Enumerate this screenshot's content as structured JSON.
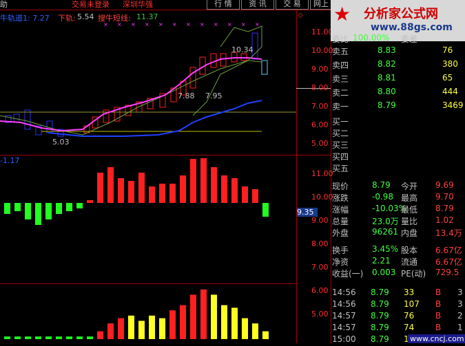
{
  "menu": {
    "help": "助",
    "account_status": "交易未登录",
    "stock_title": "深圳华强",
    "buttons": [
      "行 情",
      "资 讯",
      "交 易",
      "网上"
    ],
    "close_icon": "◇"
  },
  "watermark": {
    "title": "分析家公式网",
    "url": "www.88gs.com",
    "footer": "www.cncj.com"
  },
  "main_chart": {
    "indicator_name": "牛轨道1: 7.27",
    "lower_label": "下轨:",
    "lower_value": "5.54",
    "short_label": "搜牛短线:",
    "short_value": "11.37",
    "annotations": [
      "10.34",
      "7.88",
      "7.95",
      "5.03"
    ],
    "y_labels": [
      "11.00",
      "10.00",
      "9.00",
      "8.00",
      "7.00",
      "6.00",
      "5.00"
    ],
    "colors": {
      "up": "#ff2020",
      "down": "#3030ff",
      "pink": "#ff40ff",
      "green_line": "#70a040",
      "blue_line": "#2040ff",
      "flat": "#c0c000"
    }
  },
  "mid_chart": {
    "indicator_value": "-1.17",
    "marker": "9.35",
    "y_labels": [
      "11.00",
      "10.00",
      "9.00",
      "8.00",
      "7.00",
      "6.00",
      "5.00"
    ],
    "bars": [
      -0.4,
      -0.3,
      -0.6,
      -0.8,
      -0.6,
      -0.4,
      -0.3,
      -0.2,
      0.1,
      1.1,
      1.3,
      0.9,
      0.8,
      1.1,
      0.6,
      0.7,
      0.7,
      1.0,
      1.6,
      1.9,
      1.3,
      1.0,
      0.9,
      0.6,
      0.5,
      -0.5
    ]
  },
  "bottom_chart": {
    "bars": [
      0.1,
      0.1,
      0.1,
      0.1,
      0.1,
      0.1,
      0.1,
      0.1,
      0.1,
      0.3,
      0.6,
      0.8,
      0.9,
      0.7,
      0.9,
      0.8,
      1.1,
      1.3,
      1.7,
      1.9,
      1.7,
      1.3,
      1.2,
      0.8,
      0.6,
      0.3
    ],
    "bar_colors": [
      "g",
      "g",
      "g",
      "g",
      "g",
      "g",
      "g",
      "g",
      "g",
      "r",
      "r",
      "r",
      "y",
      "y",
      "y",
      "y",
      "r",
      "r",
      "r",
      "r",
      "y",
      "y",
      "y",
      "y",
      "y",
      "y"
    ]
  },
  "order_book": {
    "header": "000062 深圳华强",
    "ratio_label": "委比",
    "ratio_value": "100.00%",
    "diff_label": "委差",
    "sells": [
      {
        "label": "卖五",
        "price": "8.83",
        "vol": "76"
      },
      {
        "label": "卖四",
        "price": "8.82",
        "vol": "380"
      },
      {
        "label": "卖三",
        "price": "8.81",
        "vol": "65"
      },
      {
        "label": "卖二",
        "price": "8.80",
        "vol": "444"
      },
      {
        "label": "卖一",
        "price": "8.79",
        "vol": "3469"
      }
    ],
    "buys": [
      "买一",
      "买二",
      "买三",
      "买四",
      "买五"
    ]
  },
  "quote": [
    {
      "l1": "现价",
      "v1": "8.79",
      "l2": "今开",
      "v2": "9.69"
    },
    {
      "l1": "涨跌",
      "v1": "-0.98",
      "l2": "最高",
      "v2": "9.70"
    },
    {
      "l1": "涨幅",
      "v1": "-10.03%",
      "l2": "最低",
      "v2": "8.79"
    },
    {
      "l1": "总量",
      "v1": "23.0万",
      "l2": "量比",
      "v2": "1.02"
    },
    {
      "l1": "外盘",
      "v1": "96261",
      "l2": "内盘",
      "v2": "13.4万"
    },
    {
      "l1": "换手",
      "v1": "3.45%",
      "l2": "股本",
      "v2": "6.67亿"
    },
    {
      "l1": "净资",
      "v1": "2.21",
      "l2": "流通",
      "v2": "6.67亿"
    },
    {
      "l1": "收益(一)",
      "v1": "0.003",
      "l2": "PE(动)",
      "v2": "729.5"
    }
  ],
  "ticks": [
    {
      "time": "14:56",
      "price": "8.79",
      "vol": "33",
      "side": "B",
      "n": "3"
    },
    {
      "time": "14:56",
      "price": "8.79",
      "vol": "107",
      "side": "B",
      "n": "3"
    },
    {
      "time": "14:57",
      "price": "8.79",
      "vol": "76",
      "side": "B",
      "n": "2"
    },
    {
      "time": "14:57",
      "price": "8.79",
      "vol": "74",
      "side": "B",
      "n": "1"
    },
    {
      "time": "15:00",
      "price": "8.79",
      "vol": "1104",
      "side": "",
      "n": "118"
    }
  ]
}
